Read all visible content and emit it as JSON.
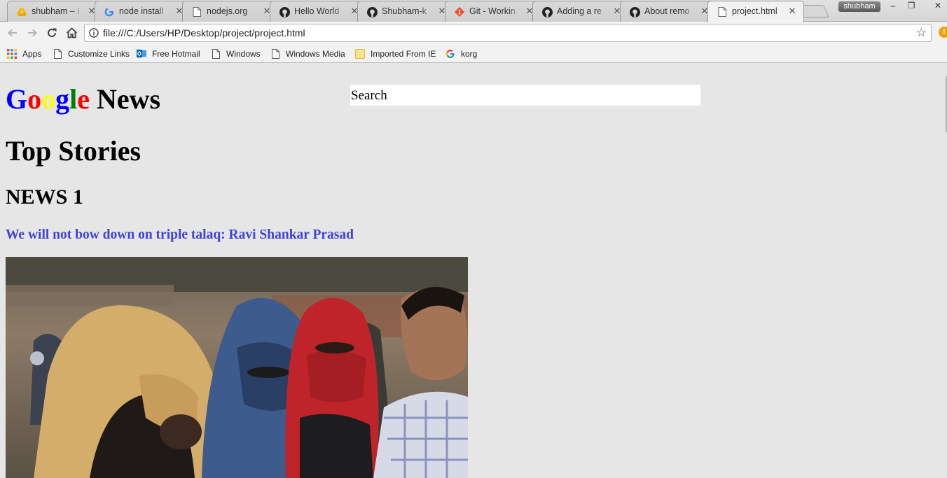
{
  "browser": {
    "tabs": [
      {
        "title": "shubham – I",
        "icon": "drive-icon"
      },
      {
        "title": "node install",
        "icon": "google-icon"
      },
      {
        "title": "nodejs.org",
        "icon": "document-icon"
      },
      {
        "title": "Hello World",
        "icon": "github-icon"
      },
      {
        "title": "Shubham-k",
        "icon": "github-icon"
      },
      {
        "title": "Git - Workin",
        "icon": "git-icon"
      },
      {
        "title": "Adding a re",
        "icon": "github-icon"
      },
      {
        "title": "About remo",
        "icon": "github-icon"
      },
      {
        "title": "project.html",
        "icon": "document-icon",
        "active": true
      }
    ],
    "close_glyph": "✕",
    "profile_name": "shubham",
    "window_controls": {
      "minimize": "‒",
      "restore": "❐",
      "close": "✕"
    },
    "address": "file:///C:/Users/HP/Desktop/project/project.html",
    "menu_badge": "!"
  },
  "bookmarks": [
    {
      "label": "Apps",
      "icon": "apps-grid-icon"
    },
    {
      "label": "Customize Links",
      "icon": "page-icon"
    },
    {
      "label": "Free Hotmail",
      "icon": "outlook-icon"
    },
    {
      "label": "Windows",
      "icon": "page-icon"
    },
    {
      "label": "Windows Media",
      "icon": "page-icon"
    },
    {
      "label": "Imported From IE",
      "icon": "folder-icon"
    },
    {
      "label": "korg",
      "icon": "google-icon"
    }
  ],
  "page": {
    "logo": {
      "letters": [
        "G",
        "o",
        "o",
        "g",
        "l",
        "e"
      ],
      "word": " News"
    },
    "search_placeholder": "Search",
    "section_title": "Top Stories",
    "news_label": "NEWS 1",
    "headline": "We will not bow down on triple talaq: Ravi Shankar Prasad",
    "colors": {
      "headline": "#4040e0",
      "background": "#e6e6e6",
      "logo_blue": "#0000ff",
      "logo_red": "#ff0000",
      "logo_yellow": "#ffff00",
      "logo_green": "#008000"
    }
  }
}
